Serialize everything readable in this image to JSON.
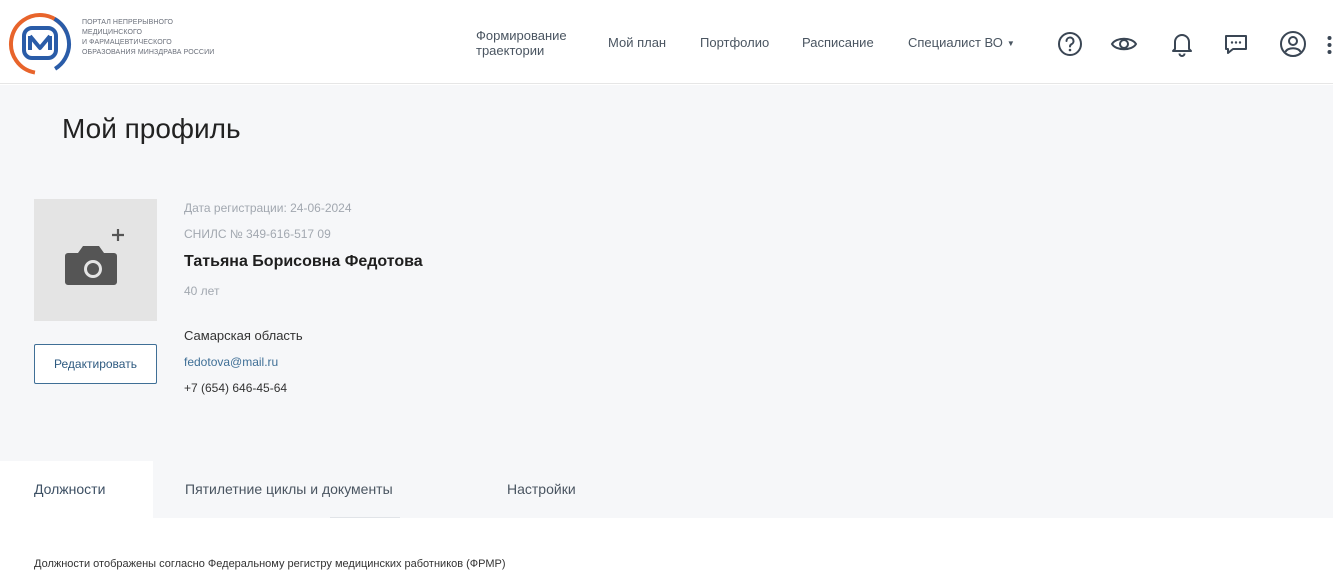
{
  "header": {
    "logo_text": [
      "ПОРТАЛ НЕПРЕРЫВНОГО",
      "МЕДИЦИНСКОГО",
      "И ФАРМАЦЕВТИЧЕСКОГО",
      "ОБРАЗОВАНИЯ МИНЗДРАВА РОССИИ"
    ],
    "nav": {
      "trajectory": "Формирование траектории",
      "my_plan": "Мой план",
      "portfolio": "Портфолио",
      "schedule": "Расписание",
      "specialist": "Специалист ВО"
    },
    "icons": [
      "help-icon",
      "eye-icon",
      "bell-icon",
      "chat-icon",
      "user-icon",
      "more-vertical-icon"
    ]
  },
  "profile": {
    "page_title": "Мой профиль",
    "registration_date": "Дата регистрации: 24-06-2024",
    "snils": "СНИЛС № 349-616-517 09",
    "full_name": "Татьяна Борисовна Федотова",
    "age": "40 лет",
    "region": "Самарская область",
    "email": "fedotova@mail.ru",
    "phone": "+7 (654) 646-45-64",
    "edit_label": "Редактировать",
    "avatar_icon": "camera-plus-icon"
  },
  "tabs": [
    {
      "label": "Должности",
      "active": true
    },
    {
      "label": "Пятилетние циклы и документы",
      "active": false
    },
    {
      "label": "Настройки",
      "active": false
    }
  ],
  "positions_note": "Должности отображены согласно Федеральному регистру медицинских работников (ФРМР)",
  "colors": {
    "accent": "#3f6f96",
    "logo_blue": "#2a5ca8",
    "logo_orange": "#e8642b",
    "profile_bg": "#f6f7f9"
  }
}
